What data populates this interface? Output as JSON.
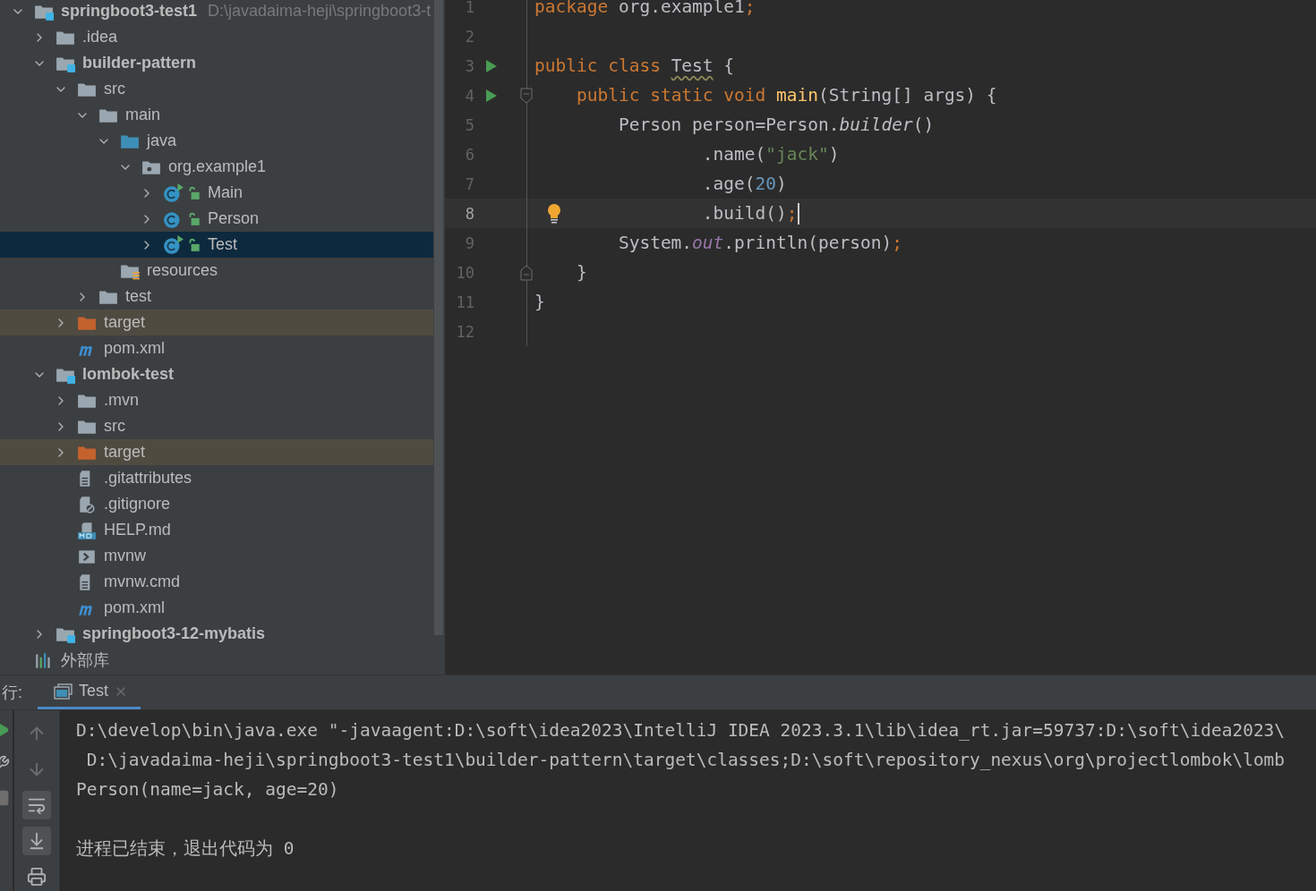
{
  "project_tree": {
    "items": [
      {
        "name": "springboot3-test1",
        "path": "D:\\javadaima-heji\\springboot3-t",
        "kind": "module",
        "expanded": true,
        "selected": false,
        "children": [
          {
            "name": ".idea",
            "kind": "folder",
            "expanded": false,
            "selected": false
          },
          {
            "name": "builder-pattern",
            "kind": "module",
            "expanded": true,
            "selected": false,
            "children": [
              {
                "name": "src",
                "kind": "folder",
                "expanded": true,
                "selected": false,
                "children": [
                  {
                    "name": "main",
                    "kind": "folder",
                    "expanded": true,
                    "selected": false,
                    "children": [
                      {
                        "name": "java",
                        "kind": "source",
                        "expanded": true,
                        "selected": false,
                        "children": [
                          {
                            "name": "org.example1",
                            "kind": "package",
                            "expanded": true,
                            "selected": false,
                            "children": [
                              {
                                "name": "Main",
                                "kind": "runnable",
                                "expanded": false,
                                "selected": false
                              },
                              {
                                "name": "Person",
                                "kind": "class",
                                "expanded": false,
                                "selected": false
                              },
                              {
                                "name": "Test",
                                "kind": "runnable",
                                "expanded": false,
                                "selected": true
                              }
                            ]
                          }
                        ]
                      },
                      {
                        "name": "resources",
                        "kind": "resources",
                        "selected": false
                      }
                    ]
                  },
                  {
                    "name": "test",
                    "kind": "folder",
                    "expanded": false,
                    "selected": false
                  }
                ]
              },
              {
                "name": "target",
                "kind": "excluded",
                "expanded": false,
                "selected": false
              },
              {
                "name": "pom.xml",
                "kind": "maven",
                "selected": false
              }
            ]
          },
          {
            "name": "lombok-test",
            "kind": "module",
            "expanded": true,
            "selected": false,
            "children": [
              {
                "name": ".mvn",
                "kind": "folder",
                "expanded": false,
                "selected": false
              },
              {
                "name": "src",
                "kind": "folder",
                "expanded": false,
                "selected": false
              },
              {
                "name": "target",
                "kind": "excluded",
                "expanded": false,
                "selected": false
              },
              {
                "name": ".gitattributes",
                "kind": "text",
                "selected": false
              },
              {
                "name": ".gitignore",
                "kind": "ignored",
                "selected": false
              },
              {
                "name": "HELP.md",
                "kind": "markdown",
                "selected": false
              },
              {
                "name": "mvnw",
                "kind": "script",
                "selected": false
              },
              {
                "name": "mvnw.cmd",
                "kind": "text",
                "selected": false
              },
              {
                "name": "pom.xml",
                "kind": "maven",
                "selected": false
              }
            ]
          },
          {
            "name": "springboot3-12-mybatis",
            "kind": "module",
            "expanded": false,
            "selected": false
          }
        ]
      },
      {
        "name": "外部库",
        "kind": "libraries",
        "selected": false
      }
    ]
  },
  "editor": {
    "lines": [
      {
        "number": "1",
        "current": false,
        "tokens": [
          {
            "kind": "keyword",
            "text": "package"
          },
          {
            "kind": "plain",
            "text": " org.example1"
          },
          {
            "kind": "semicolon",
            "text": ";"
          }
        ]
      },
      {
        "number": "2",
        "current": false
      },
      {
        "number": "3",
        "current": false,
        "gutter": [
          {
            "kind": "run"
          }
        ],
        "tokens": [
          {
            "kind": "keyword",
            "text": "public class "
          },
          {
            "kind": "warning",
            "text": "Test"
          },
          {
            "kind": "plain",
            "text": " {"
          }
        ]
      },
      {
        "number": "4",
        "current": false,
        "gutter": [
          {
            "kind": "run"
          },
          {
            "kind": "fold-start"
          }
        ],
        "tokens": [
          {
            "kind": "keyword",
            "text": "    public static void "
          },
          {
            "kind": "declaration",
            "text": "main"
          },
          {
            "kind": "plain",
            "text": "(String[] args) {"
          }
        ]
      },
      {
        "number": "5",
        "current": false,
        "tokens": [
          {
            "kind": "plain",
            "text": "        Person person=Person."
          },
          {
            "kind": "static-method",
            "text": "builder"
          },
          {
            "kind": "plain",
            "text": "()"
          }
        ]
      },
      {
        "number": "6",
        "current": false,
        "tokens": [
          {
            "kind": "plain",
            "text": "                .name("
          },
          {
            "kind": "string",
            "text": "\"jack\""
          },
          {
            "kind": "plain",
            "text": ")"
          }
        ]
      },
      {
        "number": "7",
        "current": false,
        "tokens": [
          {
            "kind": "plain",
            "text": "                .age("
          },
          {
            "kind": "number",
            "text": "20"
          },
          {
            "kind": "plain",
            "text": ")"
          }
        ]
      },
      {
        "number": "8",
        "current": true,
        "gutter": [
          {
            "kind": "bulb"
          }
        ],
        "tokens": [
          {
            "kind": "plain",
            "text": "                .build()"
          },
          {
            "kind": "semicolon",
            "text": ";"
          }
        ]
      },
      {
        "number": "9",
        "current": false,
        "tokens": [
          {
            "kind": "plain",
            "text": "        System."
          },
          {
            "kind": "static-field",
            "text": "out"
          },
          {
            "kind": "plain",
            "text": ".println(person)"
          },
          {
            "kind": "semicolon",
            "text": ";"
          }
        ]
      },
      {
        "number": "10",
        "current": false,
        "gutter": [
          {
            "kind": "fold-end"
          }
        ],
        "tokens": [
          {
            "kind": "plain",
            "text": "    }"
          }
        ]
      },
      {
        "number": "11",
        "current": false,
        "tokens": [
          {
            "kind": "plain",
            "text": "}"
          }
        ]
      },
      {
        "number": "12",
        "current": false
      }
    ]
  },
  "run_panel": {
    "label": "行:",
    "tabs": [
      {
        "title": "Test",
        "selected": true
      }
    ],
    "toolbar": [
      {
        "kind": "up",
        "on": false
      },
      {
        "kind": "down",
        "on": false
      },
      {
        "kind": "wrap",
        "on": true
      },
      {
        "kind": "scroll-end",
        "on": true
      },
      {
        "kind": "print",
        "on": false
      }
    ],
    "console": [
      {
        "kind": "command",
        "text": "D:\\develop\\bin\\java.exe \"-javaagent:D:\\soft\\idea2023\\IntelliJ IDEA 2023.3.1\\lib\\idea_rt.jar=59737:D:\\soft\\idea2023\\"
      },
      {
        "kind": "command",
        "text": " D:\\javadaima-heji\\springboot3-test1\\builder-pattern\\target\\classes;D:\\soft\\repository_nexus\\org\\projectlombok\\lomb"
      },
      {
        "kind": "output",
        "text": "Person(name=jack, age=20)"
      },
      {
        "kind": "exit",
        "text": "进程已结束，退出代码为 0"
      }
    ]
  }
}
